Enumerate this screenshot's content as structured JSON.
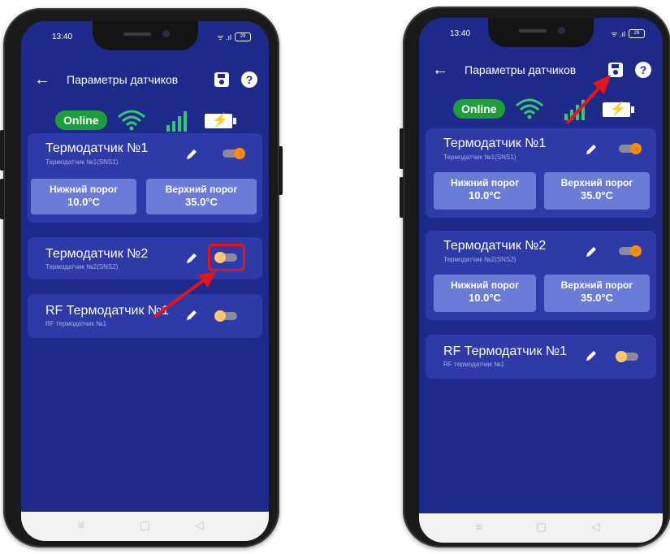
{
  "left_phone": {
    "status": {
      "time": "13:40",
      "icons": "ᯤ .ıl",
      "battery": "29"
    },
    "topbar": {
      "back": "←",
      "title": "Параметры датчиков",
      "help": "?"
    },
    "indicators": {
      "online": "Online"
    },
    "cards": [
      {
        "name": "Термодатчик №1",
        "sub": "Термодатчик №1(SNS1)",
        "toggle": "on",
        "low_label": "Нижний порог",
        "low_value": "10.0°C",
        "high_label": "Верхний порог",
        "high_value": "35.0°C"
      },
      {
        "name": "Термодатчик №2",
        "sub": "Термодатчик №2(SNS2)",
        "toggle": "off"
      },
      {
        "name": "RF Термодатчик №1",
        "sub": "RF термодатчик №1",
        "toggle": "off"
      }
    ],
    "navbar": {
      "menu": "≡",
      "home": "▢",
      "back": "◁"
    }
  },
  "right_phone": {
    "status": {
      "time": "13:40",
      "icons": "ᯤ .ıl",
      "battery": "29"
    },
    "topbar": {
      "back": "←",
      "title": "Параметры датчиков",
      "help": "?"
    },
    "indicators": {
      "online": "Online"
    },
    "cards": [
      {
        "name": "Термодатчик №1",
        "sub": "Термодатчик №1(SNS1)",
        "toggle": "on",
        "low_label": "Нижний порог",
        "low_value": "10.0°C",
        "high_label": "Верхний порог",
        "high_value": "35.0°C"
      },
      {
        "name": "Термодатчик №2",
        "sub": "Термодатчик №2(SNS2)",
        "toggle": "on",
        "low_label": "Нижний порог",
        "low_value": "10.0°C",
        "high_label": "Верхний порог",
        "high_value": "35.0°C"
      },
      {
        "name": "RF Термодатчик №1",
        "sub": "RF термодатчик №1",
        "toggle": "off"
      }
    ],
    "navbar": {
      "menu": "≡",
      "home": "▢",
      "back": "◁"
    }
  },
  "colors": {
    "screen_bg": "#1e2a8a",
    "card_bg": "#2d3aa8",
    "threshold_bg": "#6b7cd8",
    "online": "#1e9e3a",
    "toggle_on": "#ff8a00",
    "toggle_off": "#ffc870",
    "annotation": "#e3151b"
  }
}
